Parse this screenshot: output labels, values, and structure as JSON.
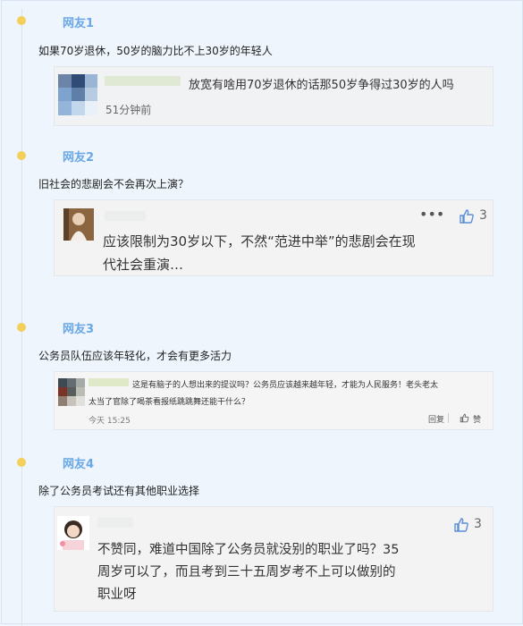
{
  "items": [
    {
      "user": "网友1",
      "question": "如果70岁退休，50岁的脑力比不上30岁的年轻人",
      "reply": {
        "text": "放宽有啥用70岁退休的话那50岁争得过30岁的人吗",
        "time": "51分钟前"
      }
    },
    {
      "user": "网友2",
      "question": "旧社会的悲剧会不会再次上演？",
      "reply": {
        "text_line1": "应该限制为30岁以下，不然“范进中举”的悲剧会在现",
        "text_line2": "代社会重演…",
        "likes": "3"
      }
    },
    {
      "user": "网友3",
      "question": "公务员队伍应该年轻化，才会有更多活力",
      "reply": {
        "text_line1": "这是有脑子的人想出来的提议吗？公务员应该越来越年轻，才能为人民服务！老头老太",
        "text_line2": "太当了官除了喝茶看报纸跳跳舞还能干什么？",
        "time": "今天 15:25",
        "reply_label": "回复",
        "like_label": "赞"
      }
    },
    {
      "user": "网友4",
      "question": "除了公务员考试还有其他职业选择",
      "reply": {
        "text_line1": "不赞同，难道中国除了公务员就没别的职业了吗？35",
        "text_line2": "周岁可以了，而且考到三十五周岁考不上可以做别的",
        "text_line3": "职业呀",
        "likes": "3"
      }
    }
  ],
  "colors": {
    "accent": "#6aa7e4",
    "dot": "#f4cf5a",
    "background": "#eef5fd",
    "card": "#f1f2f4"
  },
  "icons": [
    "thumbs-up-icon",
    "more-icon"
  ]
}
